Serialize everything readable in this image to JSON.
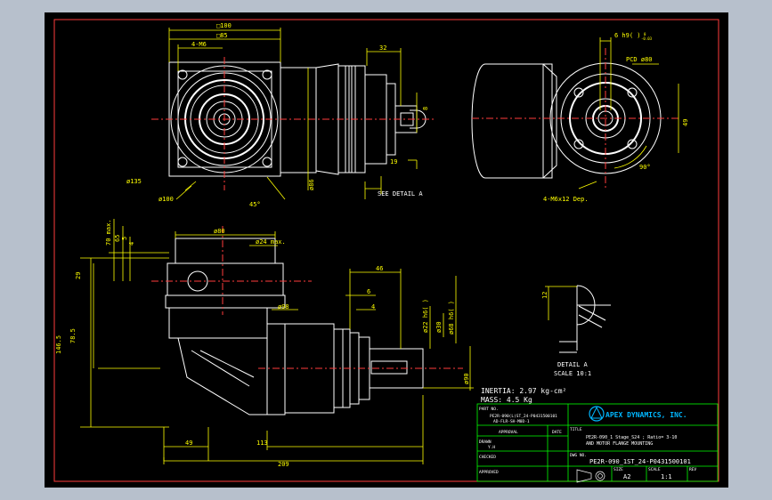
{
  "colors": {
    "background": "#000000",
    "border": "#ff3b3b",
    "geometry": "#ffffff",
    "dimension": "#ffff00",
    "titleblock": "#00ff00",
    "centerline": "#ff3b3b",
    "logo": "#00b7ff"
  },
  "top_view": {
    "square_100": "□100",
    "square_85": "□85",
    "bolt_label": "4-M6",
    "dia_135": "ø135",
    "dia_100": "ø100",
    "angle_45": "45°",
    "dia_86": "ø86",
    "dim_32": "32",
    "dim_8": "8",
    "dim_19": "19",
    "see_detail": "SEE DETAIL A"
  },
  "right_view": {
    "keyway": "6 h9(  )",
    "keyway_tol_top": "0",
    "keyway_tol_bot": "-0.03",
    "pcd": "PCD ø80",
    "dim_49": "49",
    "angle_90": "90°",
    "holes": "4-M6x12 Dep."
  },
  "front_view": {
    "dia_80": "ø80",
    "dia_24": "ø24 max.",
    "h70": "70 max.",
    "h65": "65",
    "h5": "5",
    "h4": "4",
    "h29": "29",
    "dim_46": "46",
    "dim_6": "6",
    "dim_4": "4",
    "dia_98": "ø98",
    "dia_22": "ø22 h6(  )",
    "dia_30": "ø30",
    "dia_68": "ø68 h6(  )",
    "dia_90": "ø90",
    "h146": "146.5",
    "h78": "78.5",
    "w49": "49",
    "w113": "113",
    "w209": "209"
  },
  "detail": {
    "dim_12": "12",
    "label": "DETAIL A",
    "scale": "SCALE 10:1"
  },
  "notes": {
    "inertia": "INERTIA: 2.97 kg-cm²",
    "mass": "MASS: 4.5  Kg"
  },
  "title_block": {
    "part_no_label": "PART NO.",
    "part_no_1": "PE2R-090(L)ST_24-P0431500101",
    "part_no_2": "AD-FLR-SH-M0D-1",
    "approval": "APPROVAL",
    "date": "DATE",
    "drawn": "DRAWN",
    "drawn_val": "Y.H",
    "checked": "CHECKED",
    "approved": "APPROVED",
    "company": "APEX DYNAMICS, INC.",
    "title_label": "TITLE",
    "title_1": "PE2R-090_1 Stage_S24 ; Ratio= 3-10",
    "title_2": "AND MOTOR FLANGE MOUNTING",
    "dwg_no_label": "DWG NO.",
    "dwg_no": "PE2R-090_1ST_24-P0431500101",
    "size_label": "SIZE",
    "size_val": "A2",
    "scale_label": "SCALE",
    "scale_val": "1:1",
    "rev_label": "REV"
  }
}
